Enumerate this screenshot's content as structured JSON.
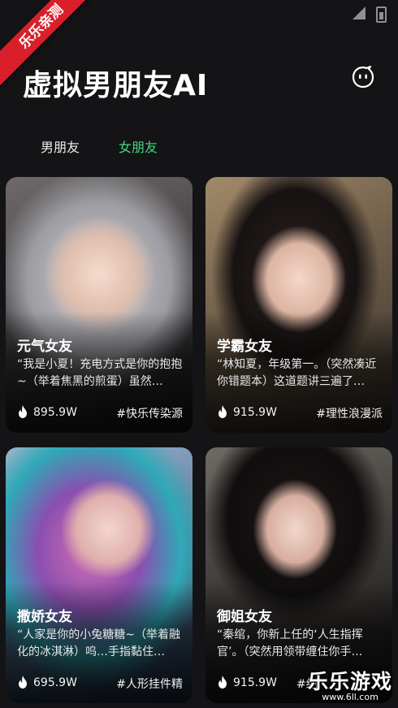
{
  "ribbon": "乐乐亲测",
  "title": "虚拟男朋友AI",
  "tabs": [
    {
      "label": "男朋友",
      "active": false
    },
    {
      "label": "女朋友",
      "active": true
    }
  ],
  "accent_color": "#45d483",
  "cards": [
    {
      "name": "元气女友",
      "desc": "“我是小夏！充电方式是你的抱抱~（举着焦黑的煎蛋）虽然…",
      "count": "895.9W",
      "tag": "#快乐传染源"
    },
    {
      "name": "学霸女友",
      "desc": "“林知夏，年级第一。（突然凑近你错题本）这道题讲三遍了…",
      "count": "915.9W",
      "tag": "#理性浪漫派"
    },
    {
      "name": "撒娇女友",
      "desc": "“人家是你的小兔糖糖~（举着融化的冰淇淋）呜…手指黏住…",
      "count": "695.9W",
      "tag": "#人形挂件精"
    },
    {
      "name": "御姐女友",
      "desc": "“秦绾，你新上任的‘人生指挥官’。（突然用领带缠住你手…",
      "count": "915.9W",
      "tag": "#绝"
    }
  ],
  "watermark": {
    "brand": "乐乐游戏",
    "url": "www.6ll.com"
  }
}
